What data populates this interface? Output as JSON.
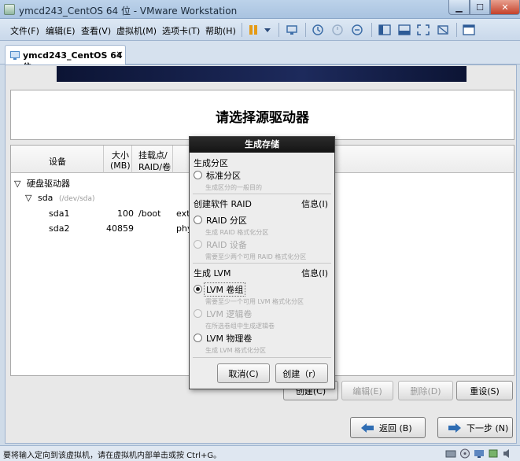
{
  "window": {
    "title": "ymcd243_CentOS 64 位 - VMware Workstation",
    "min_icon": "minimize-icon",
    "max_icon": "maximize-icon",
    "close_icon": "close-icon"
  },
  "menu": {
    "items": [
      "文件(F)",
      "编辑(E)",
      "查看(V)",
      "虚拟机(M)",
      "选项卡(T)",
      "帮助(H)"
    ]
  },
  "toolbar": {
    "icons": [
      "pause-icon",
      "dropdown-icon",
      "send-ctrl-alt-del-icon",
      "snapshot-icon",
      "revert-snapshot-icon",
      "snapshot-manager-icon",
      "sidebar-icon",
      "console-view-icon",
      "fullscreen-icon",
      "unity-icon",
      "thumbnail-icon"
    ]
  },
  "tab": {
    "label": "ymcd243_CentOS 64 位",
    "close": "×"
  },
  "installer": {
    "page_title": "请选择源驱动器",
    "columns": {
      "device": "设备",
      "size_line1": "大小",
      "size_line2": "(MB)",
      "mount_line1": "挂载点/",
      "mount_line2": "RAID/卷"
    },
    "tree": {
      "root": "硬盘驱动器",
      "disk": "sda",
      "disk_path": "(/dev/sda)",
      "partitions": [
        {
          "name": "sda1",
          "size": "100",
          "mount": "/boot",
          "type": "ext4"
        },
        {
          "name": "sda2",
          "size": "40859",
          "mount": "",
          "type": "phy"
        }
      ]
    },
    "buttons": {
      "create": "创建(C)",
      "edit": "编辑(E)",
      "delete": "删除(D)",
      "reset": "重设(S)",
      "back": "返回 (B)",
      "next": "下一步 (N)"
    }
  },
  "dialog": {
    "title": "生成存储",
    "section_partition": "生成分区",
    "opt_standard": "标准分区",
    "opt_standard_desc": "生成区分的一般目的",
    "section_raid": "创建软件 RAID",
    "info_raid": "信息(I)",
    "opt_raid_partition": "RAID 分区",
    "opt_raid_partition_desc": "生成 RAID 格式化分区",
    "opt_raid_device": "RAID 设备",
    "opt_raid_device_desc": "需要至少两个可用 RAID 格式化分区",
    "section_lvm": "生成 LVM",
    "info_lvm": "信息(I)",
    "opt_lvm_vg": "LVM 卷组",
    "opt_lvm_vg_desc": "需要至少一个可用 LVM 格式化分区",
    "opt_lvm_lv": "LVM 逻辑卷",
    "opt_lvm_lv_desc": "在所选卷组中生成逻辑卷",
    "opt_lvm_pv": "LVM 物理卷",
    "opt_lvm_pv_desc": "生成 LVM 格式化分区",
    "cancel": "取消(C)",
    "create": "创建（r）",
    "selected": "LVM 卷组"
  },
  "statusbar": {
    "text": "要将输入定向到该虚拟机，请在虚拟机内部单击或按 Ctrl+G。"
  },
  "colors": {
    "accent": "#1f6fc4",
    "banner": "#111a40"
  }
}
